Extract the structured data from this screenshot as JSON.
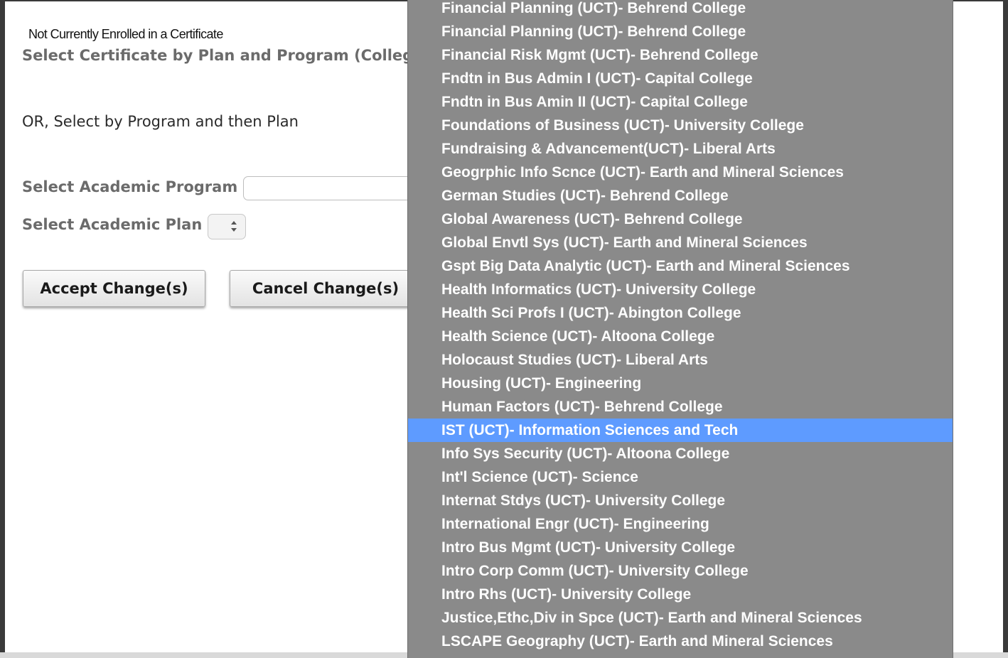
{
  "form": {
    "status_text": "Not Currently Enrolled in a Certificate",
    "heading": "Select Certificate by Plan and Program (College",
    "or_text": "OR, Select by Program and then Plan",
    "program_label": "Select Academic Program",
    "plan_label": "Select Academic Plan",
    "program_value": "",
    "accept_label": "Accept Change(s)",
    "cancel_label": "Cancel Change(s)"
  },
  "dropdown": {
    "selected_index": 18,
    "options": [
      "Financial Planning (UCT)- Behrend College",
      "Financial Planning (UCT)- Behrend College",
      "Financial Risk Mgmt (UCT)- Behrend College",
      "Fndtn in Bus Admin I (UCT)- Capital College",
      "Fndtn in Bus Amin II (UCT)- Capital College",
      "Foundations of Business (UCT)- University College",
      "Fundraising & Advancement(UCT)- Liberal Arts",
      "Geogrphic Info Scnce (UCT)- Earth and Mineral Sciences",
      "German Studies (UCT)- Behrend College",
      "Global Awareness (UCT)- Behrend College",
      "Global Envtl Sys (UCT)- Earth and Mineral Sciences",
      "Gspt Big Data Analytic (UCT)- Earth and Mineral Sciences",
      "Health Informatics (UCT)- University College",
      "Health Sci Profs I (UCT)- Abington College",
      "Health Science (UCT)- Altoona College",
      "Holocaust Studies (UCT)- Liberal Arts",
      "Housing (UCT)- Engineering",
      "Human Factors (UCT)- Behrend College",
      "IST (UCT)- Information Sciences and Tech",
      "Info Sys Security (UCT)- Altoona College",
      "Int'l Science (UCT)- Science",
      "Internat Stdys (UCT)- University College",
      "International Engr (UCT)- Engineering",
      "Intro Bus Mgmt (UCT)- University College",
      "Intro Corp Comm (UCT)- University College",
      "Intro Rhs (UCT)- University College",
      "Justice,Ethc,Div in Spce (UCT)- Earth and Mineral Sciences",
      "LSCAPE Geography (UCT)- Earth and Mineral Sciences"
    ]
  }
}
